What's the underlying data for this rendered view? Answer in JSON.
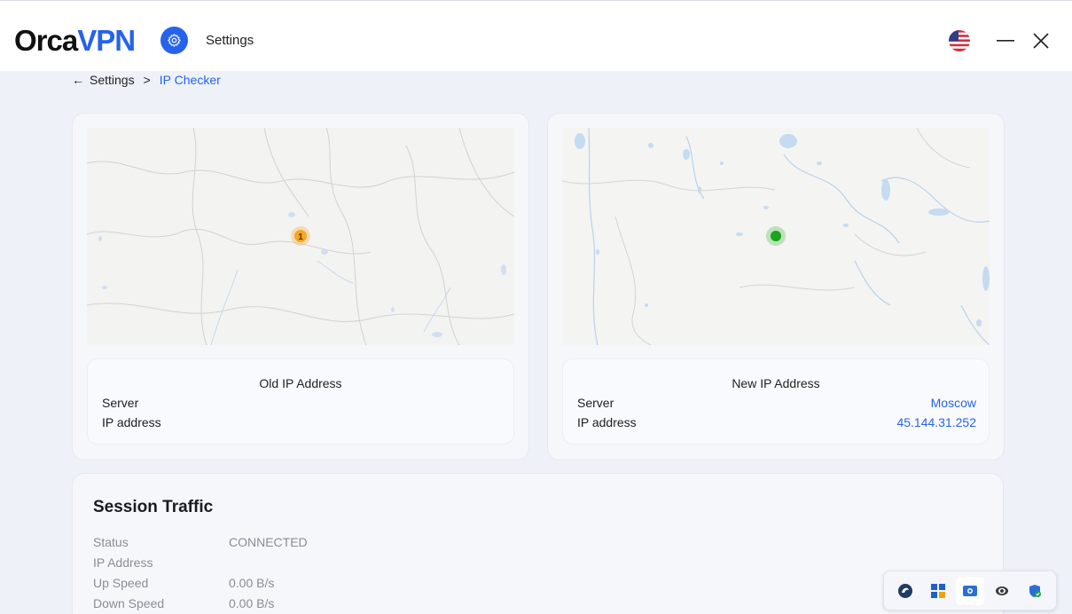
{
  "top_fragment": "page",
  "app": {
    "logo_part1": "Orca",
    "logo_part2": "VPN",
    "title": "Settings"
  },
  "breadcrumb": {
    "back_arrow": "←",
    "root": "Settings",
    "separator": ">",
    "current": "IP Checker"
  },
  "old_ip": {
    "heading": "Old IP Address",
    "server_label": "Server",
    "server_value": "",
    "ip_label": "IP address",
    "ip_value": "",
    "marker_label": "1",
    "marker_color": "#f5a623"
  },
  "new_ip": {
    "heading": "New IP Address",
    "server_label": "Server",
    "server_value": "Moscow",
    "ip_label": "IP address",
    "ip_value": "45.144.31.252",
    "marker_color": "#1aa51a"
  },
  "session": {
    "title": "Session Traffic",
    "rows": [
      {
        "label": "Status",
        "value": "CONNECTED"
      },
      {
        "label": "IP Address",
        "value": ""
      },
      {
        "label": "Up Speed",
        "value": "0.00 B/s"
      },
      {
        "label": "Down Speed",
        "value": "0.00 B/s"
      }
    ]
  },
  "tray": {
    "icons": [
      "orcavpn-icon",
      "apps-grid-icon",
      "camera-icon",
      "eye-icon",
      "shield-check-icon"
    ]
  },
  "colors": {
    "accent": "#2563eb",
    "background": "#eef1f8"
  }
}
